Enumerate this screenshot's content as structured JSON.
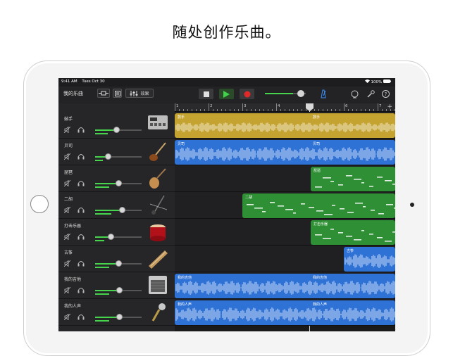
{
  "headline": "随处创作乐曲。",
  "status": {
    "time": "9:41 AM",
    "date": "Tues Oct 30",
    "battery": "100%"
  },
  "toolbar": {
    "my_songs": "我的乐曲",
    "effects": "效果"
  },
  "tracks": [
    {
      "name": "鼓手",
      "region": "鼓手",
      "color": "#c4a330",
      "instrument": "drum-machine-icon"
    },
    {
      "name": "贝司",
      "region": "贝司",
      "color": "#2f72d6",
      "instrument": "bass-guitar-icon"
    },
    {
      "name": "琵琶",
      "region": "琵琶",
      "color": "#2f8f35",
      "instrument": "pipa-icon"
    },
    {
      "name": "二胡",
      "region": "二胡",
      "color": "#2f8f35",
      "instrument": "erhu-icon"
    },
    {
      "name": "打击乐器",
      "region": "打击乐器",
      "color": "#2f8f35",
      "instrument": "chinese-drum-icon"
    },
    {
      "name": "古筝",
      "region": "古筝",
      "color": "#2f72d6",
      "instrument": "guzheng-icon"
    },
    {
      "name": "我的吉他",
      "region": "我的吉他",
      "color": "#2f72d6",
      "instrument": "guitar-amp-icon"
    },
    {
      "name": "我的人声",
      "region": "我的人声",
      "color": "#2f72d6",
      "instrument": "microphone-icon"
    }
  ],
  "ruler": [
    "1",
    "2",
    "3",
    "4",
    "5",
    "6",
    "7"
  ]
}
